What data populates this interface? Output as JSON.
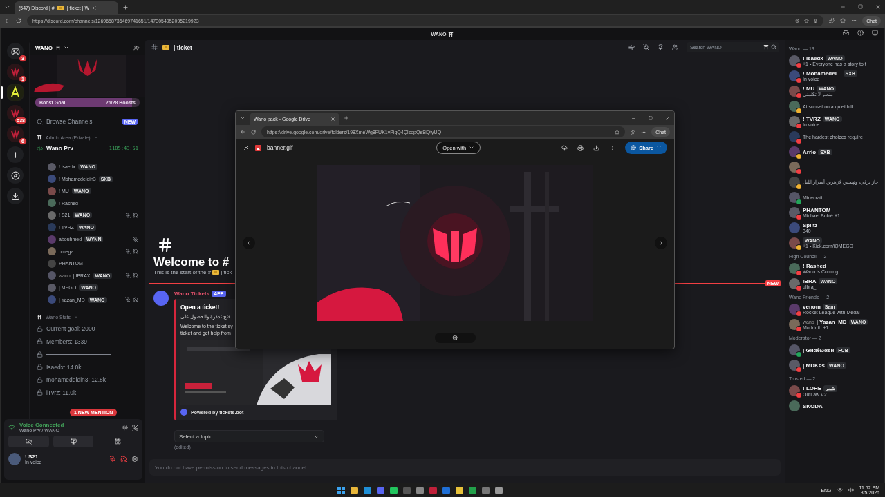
{
  "browser": {
    "tab_title_start": "(547) Discord | #",
    "tab_title_end": "| ticket | W",
    "url": "https://discord.com/channels/1269658736469741651/1473054952095219923",
    "chat": "Chat"
  },
  "discord": {
    "title": "WANO",
    "rail": [
      {
        "kind": "home",
        "badge": "3",
        "selected": false
      },
      {
        "kind": "server",
        "badge": "1",
        "selected": false
      },
      {
        "kind": "server",
        "selected": true
      },
      {
        "kind": "server",
        "badge": "538",
        "selected": false
      },
      {
        "kind": "server",
        "badge": "6",
        "selected": false
      },
      {
        "kind": "add"
      },
      {
        "kind": "discover"
      },
      {
        "kind": "download"
      }
    ],
    "server": {
      "name": "WANO",
      "boost_label": "Boost Goal",
      "boost_count": "26/28 Boosts",
      "level": 0.93
    },
    "browse": {
      "label": "Browse Channels",
      "badge": "NEW"
    },
    "voice_category": {
      "name": "Admin Area (Private)",
      "channel": "Wano Prv",
      "timer": "1105:43:51",
      "users": [
        {
          "name": "! isaedx",
          "tag": "WANO",
          "muted": false,
          "deafened": false
        },
        {
          "name": "! Mohamedeldin3",
          "tag": "SXB",
          "muted": false,
          "deafened": false
        },
        {
          "name": "! MU",
          "tag": "WANO",
          "muted": false,
          "deafened": false
        },
        {
          "name": "! Rashed",
          "muted": false,
          "deafened": false
        },
        {
          "name": "! S21",
          "tag": "WANO",
          "muted": true,
          "deafened": true
        },
        {
          "name": "! TVRZ",
          "tag": "WANO",
          "muted": false,
          "deafened": false
        },
        {
          "name": "abouhmed",
          "tag": "WYNN",
          "muted": true,
          "deafened": false
        },
        {
          "name": "omega",
          "muted": true,
          "deafened": true
        },
        {
          "name": "PHANTOM",
          "muted": false,
          "deafened": false
        },
        {
          "prefix": "wano",
          "name": "| IBRAX",
          "tag": "WANO",
          "muted": true,
          "deafened": true
        },
        {
          "name": "| MEGO",
          "tag": "WANO",
          "muted": false,
          "deafened": false
        },
        {
          "name": "| Yazan_MD",
          "tag": "WANO",
          "muted": true,
          "deafened": true
        }
      ]
    },
    "stats_category": {
      "name": "Wano Stats",
      "channels": [
        {
          "kind": "text",
          "name": "Current goal: 2000"
        },
        {
          "kind": "text",
          "name": "Members: 1339"
        },
        {
          "kind": "rule"
        },
        {
          "kind": "text",
          "name": "Isaedx: 14.0k"
        },
        {
          "kind": "text",
          "name": "mohamedeldin3: 12.8k"
        },
        {
          "kind": "text",
          "name": "iTvrz: 11.0k"
        }
      ]
    },
    "mention": "1 NEW MENTION",
    "voice_panel": {
      "status": "Voice Connected",
      "channel": "Wano Prv / WANO"
    },
    "user": {
      "name": "! S21",
      "status": "In voice",
      "muted": true,
      "deafened": true
    },
    "channel": {
      "name": "| ticket",
      "search_placeholder": "Search WANO"
    },
    "welcome": {
      "title": "Welcome to #",
      "subtitle": "This is the start of the #",
      "subtitle_tail": "| tick"
    },
    "divider_badge": "NEW",
    "message": {
      "author": "Wano Tickets",
      "badge": "APP",
      "embed_title": "Open a ticket!",
      "embed_arabic": "فتح تذكرة والحصول على",
      "embed_text": "Welcome to the ticket sy\nticket and get help from",
      "footer": "Powered by tickets.bot",
      "select_placeholder": "Select a topic...",
      "edited": "(edited)"
    },
    "composer_placeholder": "You do not have permission to send messages in this channel.",
    "member_groups": [
      {
        "title": "Wano — 13",
        "members": [
          {
            "name": "! isaedx",
            "tag": "WANO",
            "activity": "+1 • Everyone has a story to t",
            "color": "#f23f43"
          },
          {
            "name": "! Mohamedel...",
            "tag": "SXB",
            "activity": "In voice",
            "color": "#f23f43"
          },
          {
            "name": "! MU",
            "tag": "WANO",
            "activity": "منصر لا تكلمني",
            "color": "#f23f43"
          },
          {
            "activity": "At sunset on a quiet hill...",
            "color": "#f0b232"
          },
          {
            "name": "! TVRZ",
            "tag": "WANO",
            "activity": "In voice",
            "color": "#f23f43"
          },
          {
            "activity": "The hardest choices require",
            "color": "#f23f43"
          },
          {
            "name": "Arrio",
            "tag": "SXB",
            "color": "#f0b232"
          },
          {
            "color": "#f23f43"
          },
          {
            "activity": "جاز برقي، وتهمس لازهرين أسرار الليل",
            "color": "#f0b232"
          },
          {
            "activity": "Minecraft",
            "color": "#23a55a"
          },
          {
            "name": "PHANTOM",
            "activity": "Michael Bublé +1",
            "color": "#f23f43"
          },
          {
            "name": "Splitz",
            "activity": "340"
          },
          {
            "tag": "WANO",
            "activity": "+1 • Kick.com/iQMEGO",
            "color": "#f0b232"
          }
        ]
      },
      {
        "title": "High Council — 2",
        "members": [
          {
            "name": "! Rashed",
            "activity": "Wano is Coming",
            "color": "#f23f43"
          },
          {
            "name": "IBRA",
            "tag": "WANO",
            "activity": "ulbra_",
            "color": "#f23f43"
          }
        ]
      },
      {
        "title": "Wano Friends — 2",
        "members": [
          {
            "name": "venom",
            "tag": "Sam",
            "activity": "Rocket League with Medal",
            "color": "#f23f43"
          },
          {
            "prefix": "wano",
            "name": "| Yazan_MD",
            "tag": "WANO",
            "activity": "Modrinth +1",
            "color": "#f23f43"
          }
        ]
      },
      {
        "title": "Moderator — 2",
        "members": [
          {
            "name": "| Gнαℓωαѕн",
            "tag": "FCB",
            "color": "#23a55a"
          },
          {
            "name": "| MDKᴘs",
            "tag": "WANO",
            "color": "#f23f43"
          }
        ]
      },
      {
        "title": "Trusted — 2",
        "members": [
          {
            "name": "! LOHE",
            "tag": "شمر",
            "activity": "OutLaw V2",
            "color": "#f23f43"
          },
          {
            "name": "SKODA"
          }
        ]
      }
    ]
  },
  "viewer": {
    "tab": "Wano pack - Google Drive",
    "url": "https://drive.google.com/drive/folders/198XmeWg8FUK1vPiqQ4QlsopQe8iQtyUQ",
    "chat": "Chat",
    "file": "banner.gif",
    "open_with": "Open with",
    "share": "Share"
  },
  "taskbar": {
    "language": "ENG",
    "time": "11:52 PM",
    "date": "3/5/2026"
  }
}
